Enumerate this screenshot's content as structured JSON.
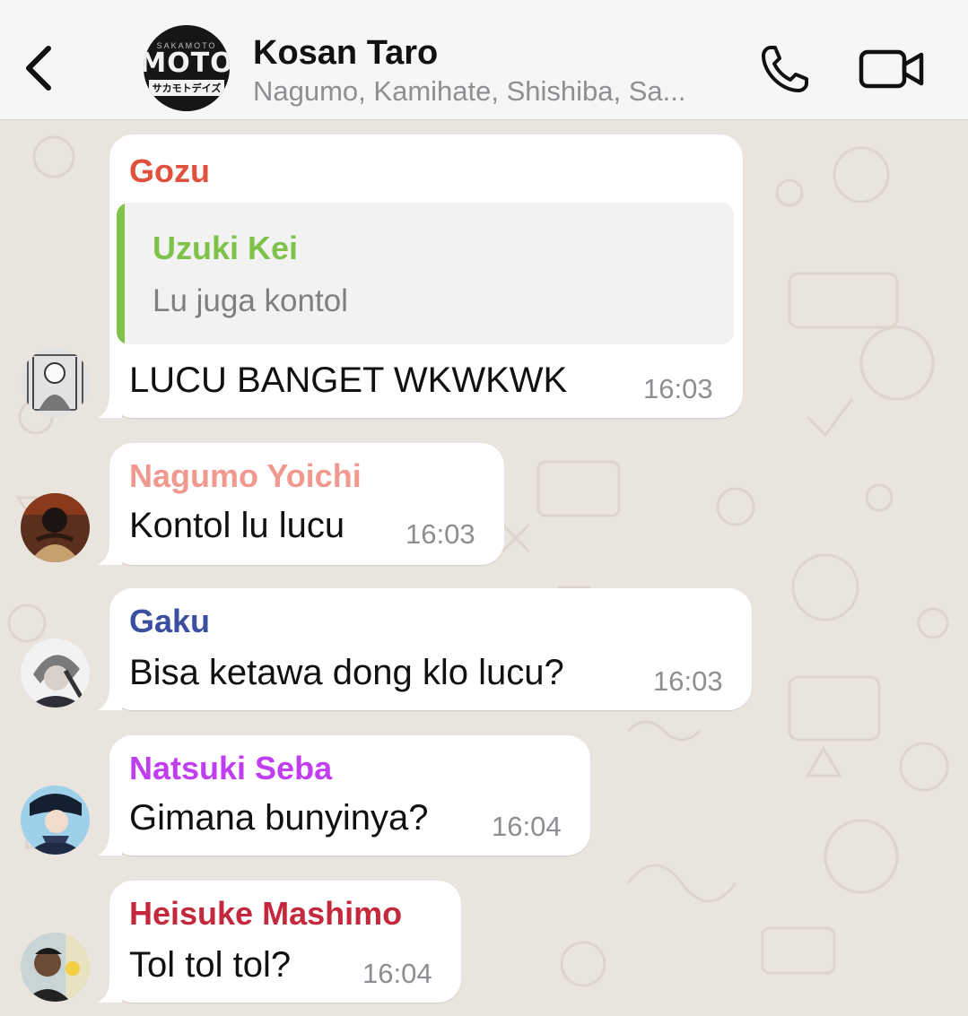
{
  "header": {
    "title": "Kosan Taro",
    "members": "Nagumo, Kamihate, Shishiba, Sa...",
    "avatar_small_text": "SAKAMOTO",
    "avatar_logo_text": "MOTO",
    "avatar_kana_text": "サカモトデイズ",
    "back_icon": "chevron-left-icon",
    "call_icon": "phone-icon",
    "video_icon": "video-camera-icon"
  },
  "colors": {
    "header_bg": "#f6f6f6",
    "chat_bg": "#e9e4dd",
    "bubble_bg": "#ffffff",
    "quote_bar": "#7ec24a"
  },
  "messages": [
    {
      "sender": "Gozu",
      "sender_color": "#e0503c",
      "quote": {
        "name": "Uzuki Kei",
        "name_color": "#7ec24a",
        "text": "Lu juga kontol"
      },
      "text": "LUCU BANGET WKWKWK",
      "time": "16:03"
    },
    {
      "sender": "Nagumo Yoichi",
      "sender_color": "#f2998f",
      "text": "Kontol lu lucu",
      "time": "16:03"
    },
    {
      "sender": "Gaku",
      "sender_color": "#3b4fa0",
      "text": "Bisa ketawa dong klo lucu?",
      "time": "16:03"
    },
    {
      "sender": "Natsuki Seba",
      "sender_color": "#c03df0",
      "text": "Gimana bunyinya?",
      "time": "16:04"
    },
    {
      "sender": "Heisuke Mashimo",
      "sender_color": "#c4283c",
      "text": "Tol tol tol?",
      "time": "16:04"
    }
  ]
}
